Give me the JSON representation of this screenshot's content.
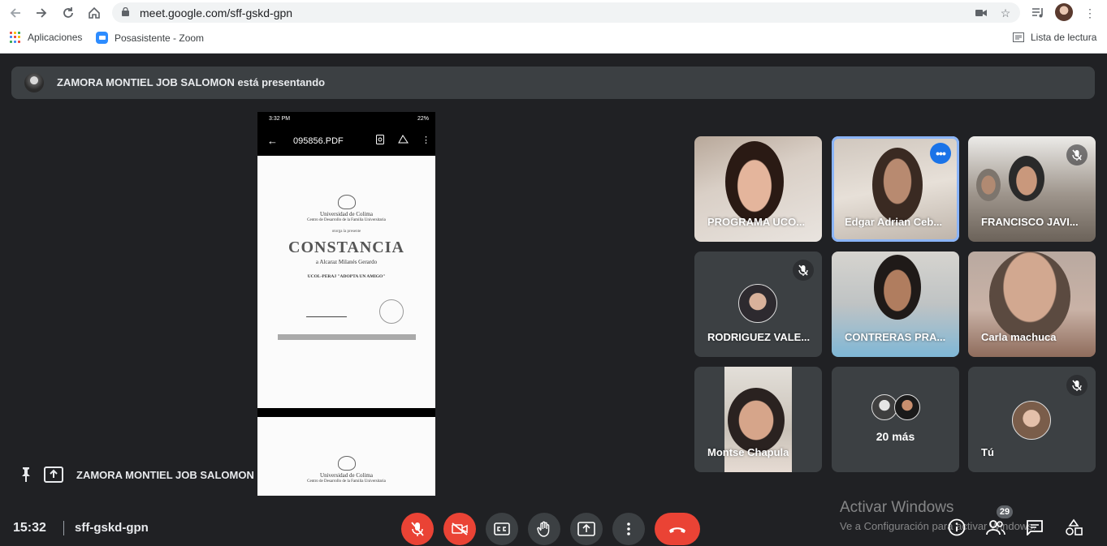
{
  "browser": {
    "url": "meet.google.com/sff-gskd-gpn",
    "bookmarks": [
      {
        "label": "Aplicaciones",
        "icon": "apps-grid-icon"
      },
      {
        "label": "Posasistente - Zoom",
        "icon": "zoom-icon"
      }
    ],
    "reading_list": "Lista de lectura"
  },
  "presenter_bar": {
    "text": "ZAMORA MONTIEL JOB SALOMON está presentando"
  },
  "shared_screen": {
    "status_time": "3:32 PM",
    "battery": "22%",
    "file_name": "095856.PDF",
    "document": {
      "university": "Universidad de Colima",
      "center": "Centro de Desarrollo de la Familia Universitaria",
      "grants": "otorga la presente",
      "title": "CONSTANCIA",
      "recipient": "a Alcaraz Milanés Gerardo",
      "program": "UCOL-PERAJ \"ADOPTA UN AMIGO\""
    }
  },
  "participants": [
    {
      "name": "PROGRAMA UCO...",
      "muted": false,
      "selected": false
    },
    {
      "name": "Edgar Adrian Ceb...",
      "muted": false,
      "selected": true
    },
    {
      "name": "FRANCISCO JAVI...",
      "muted": true,
      "selected": false
    },
    {
      "name": "RODRIGUEZ VALE...",
      "muted": true,
      "selected": false
    },
    {
      "name": "CONTRERAS PRA...",
      "muted": false,
      "selected": false
    },
    {
      "name": "Carla machuca",
      "muted": false,
      "selected": false
    },
    {
      "name": "Montse Chapula",
      "muted": false,
      "selected": false
    },
    {
      "name": "20 más",
      "muted": false,
      "selected": false
    },
    {
      "name": "Tú",
      "muted": true,
      "selected": false
    }
  ],
  "presenting_label": "ZAMORA MONTIEL JOB SALOMON",
  "footer": {
    "time": "15:32",
    "meeting_code": "sff-gskd-gpn",
    "participant_count": "29"
  },
  "controls": [
    "mic-off",
    "camera-off",
    "captions",
    "raise-hand",
    "present",
    "more",
    "leave-call"
  ],
  "right_controls": [
    "info",
    "people",
    "chat",
    "activities"
  ],
  "watermark": {
    "title": "Activar Windows",
    "subtitle": "Ve a Configuración para activar Windows."
  },
  "colors": {
    "background": "#202124",
    "tile": "#3c4043",
    "danger": "#ea4335",
    "accent": "#1a73e8",
    "selected_outline": "#8ab4f8"
  }
}
